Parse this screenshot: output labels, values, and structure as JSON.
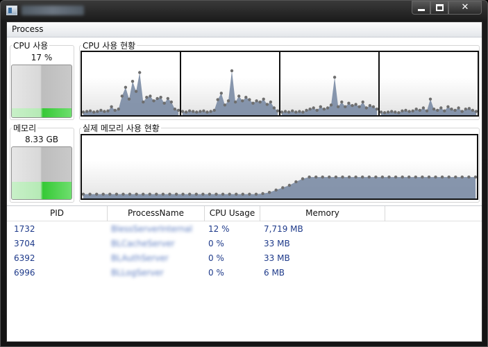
{
  "window": {
    "title": "EMS-BLES-CC"
  },
  "menu": {
    "items": [
      "Process"
    ]
  },
  "cpu_meter": {
    "label": "CPU 사용",
    "value_text": "17 %",
    "level": 0.17
  },
  "cpu_history": {
    "label": "CPU 사용 현황",
    "cores": [
      [
        3,
        4,
        5,
        3,
        4,
        6,
        4,
        5,
        12,
        6,
        8,
        30,
        45,
        25,
        55,
        38,
        70,
        20,
        28,
        30,
        22,
        26,
        28,
        18,
        26,
        20,
        8,
        6
      ],
      [
        4,
        3,
        5,
        4,
        3,
        4,
        5,
        3,
        4,
        6,
        24,
        35,
        15,
        22,
        73,
        20,
        30,
        22,
        28,
        24,
        18,
        22,
        20,
        25,
        16,
        20,
        10,
        5
      ],
      [
        3,
        4,
        3,
        5,
        3,
        4,
        3,
        6,
        8,
        10,
        6,
        12,
        8,
        10,
        15,
        62,
        12,
        20,
        12,
        18,
        14,
        16,
        12,
        20,
        10,
        14,
        12,
        8
      ],
      [
        3,
        2,
        3,
        4,
        3,
        2,
        5,
        6,
        4,
        5,
        8,
        6,
        10,
        5,
        25,
        8,
        6,
        10,
        5,
        12,
        8,
        6,
        10,
        4,
        8,
        9,
        6,
        4
      ]
    ]
  },
  "memory_meter": {
    "label": "메모리",
    "value_text": "8.33 GB",
    "level": 0.33
  },
  "memory_history": {
    "label": "실제 메모리 사용 현황",
    "values": [
      5,
      5,
      5,
      5,
      5,
      5,
      5,
      5,
      5,
      5,
      5,
      5,
      5,
      5,
      5,
      5,
      5,
      5,
      5,
      5,
      5,
      5,
      5,
      5,
      5,
      5,
      5,
      6,
      8,
      12,
      16,
      20,
      26,
      31,
      34,
      34,
      34,
      34,
      34,
      34,
      34,
      34,
      34,
      34,
      34,
      34,
      34,
      34,
      34,
      34,
      34,
      34,
      34,
      34,
      34,
      34,
      34,
      34,
      34,
      34
    ],
    "ymax": 100
  },
  "table": {
    "columns": [
      "PID",
      "ProcessName",
      "CPU Usage",
      "Memory"
    ],
    "rows": [
      {
        "pid": "1732",
        "name": "BlessServerInternal",
        "cpu": "12 %",
        "memory": "7,719 MB"
      },
      {
        "pid": "3704",
        "name": "BLCacheServer",
        "cpu": "0 %",
        "memory": "33 MB"
      },
      {
        "pid": "6392",
        "name": "BLAuthServer",
        "cpu": "0 %",
        "memory": "33 MB"
      },
      {
        "pid": "6996",
        "name": "BLLogServer",
        "cpu": "0 %",
        "memory": "6 MB"
      }
    ]
  },
  "colors": {
    "graph_fill": "#7a8ba4",
    "graph_dot": "#6e6e6e",
    "meter_green": "#3ccd3c",
    "row_text": "#1e3a8a"
  }
}
